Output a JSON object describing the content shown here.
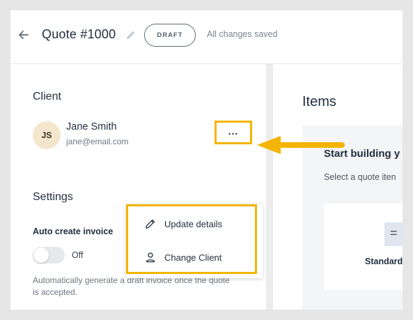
{
  "header": {
    "title": "Quote #1000",
    "status_badge": "DRAFT",
    "save_status": "All changes saved"
  },
  "client": {
    "heading": "Client",
    "initials": "JS",
    "name": "Jane Smith",
    "email": "jane@email.com",
    "more_label": "..."
  },
  "client_menu": {
    "items": [
      {
        "label": "Update details",
        "icon": "pencil-icon"
      },
      {
        "label": "Change Client",
        "icon": "person-icon"
      }
    ]
  },
  "settings": {
    "heading": "Settings",
    "auto_invoice_label": "Auto create invoice",
    "toggle_state": "Off",
    "help_text": "Automatically generate a draft invoice once the quote is accepted."
  },
  "items": {
    "heading": "Items",
    "start_heading": "Start building y",
    "select_text": "Select a quote iten",
    "standard_label": "Standard",
    "standard_icon_glyph": "="
  },
  "colors": {
    "highlight": "#f4b400",
    "avatar_bg": "#f3e6cc"
  }
}
